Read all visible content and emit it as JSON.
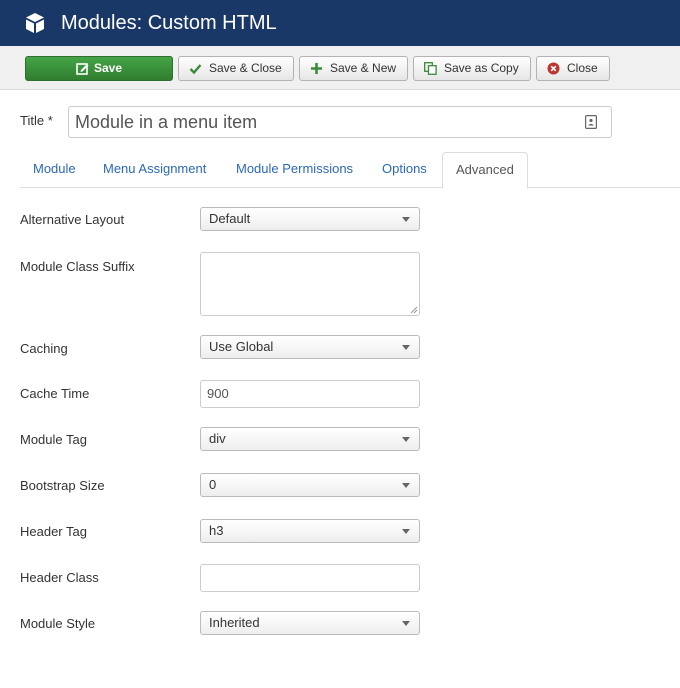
{
  "header": {
    "title": "Modules: Custom HTML",
    "icon": "cube-icon",
    "bg_color": "#1a3867"
  },
  "toolbar": {
    "save": "Save",
    "save_close": "Save & Close",
    "save_new": "Save & New",
    "save_copy": "Save as Copy",
    "close": "Close"
  },
  "title_field": {
    "label": "Title *",
    "value": "Module in a menu item"
  },
  "tabs": [
    "Module",
    "Menu Assignment",
    "Module Permissions",
    "Options",
    "Advanced"
  ],
  "active_tab": "Advanced",
  "fields": {
    "alt_layout": {
      "label": "Alternative Layout",
      "value": "Default"
    },
    "class_suffix": {
      "label": "Module Class Suffix",
      "value": ""
    },
    "caching": {
      "label": "Caching",
      "value": "Use Global"
    },
    "cache_time": {
      "label": "Cache Time",
      "value": "900"
    },
    "module_tag": {
      "label": "Module Tag",
      "value": "div"
    },
    "bootstrap_size": {
      "label": "Bootstrap Size",
      "value": "0"
    },
    "header_tag": {
      "label": "Header Tag",
      "value": "h3"
    },
    "header_class": {
      "label": "Header Class",
      "value": ""
    },
    "module_style": {
      "label": "Module Style",
      "value": "Inherited"
    }
  },
  "colors": {
    "save_green": "#46a546",
    "link_blue": "#2a69b8",
    "close_red": "#bd362f"
  }
}
